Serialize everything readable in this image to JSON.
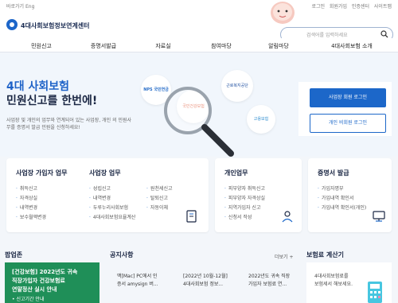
{
  "topbar": {
    "left": "바로가기  Eng",
    "right": "로그인  회원가입  인증센터  사이트맵"
  },
  "header": {
    "logo_text": "4대사회보험정보연계센터",
    "search_placeholder": "검색어를 입력하세요"
  },
  "nav": [
    "민원신고",
    "증명서발급",
    "자료실",
    "참여마당",
    "알림마당",
    "4대사회보험 소개"
  ],
  "hero": {
    "title_line1": "4대 사회보험",
    "title_line2": "민원신고를 한번에!",
    "desc": "사업장 및 개인의 업무와 연계되어 있는 사업장, 개인 의 민원사무를 증명서 발급 민원을 신청하세요!",
    "bubbles": [
      "NPS 국민연금",
      "국민건강보험",
      "근로복지공단",
      "고용보험"
    ]
  },
  "login": {
    "primary": "사업장 회원 로그인",
    "secondary": "개인 비회원 로그인"
  },
  "cards": [
    {
      "title": "사업장 가입자 업무",
      "items": [
        "취득신고",
        "자격상실",
        "내역변경",
        "보수월액변경"
      ]
    },
    {
      "title": "사업장 업무",
      "items": [
        "성립신고",
        "내역변경",
        "두루누리사회보험",
        "4대사회보험요율계산",
        "원천세신고",
        "탈퇴신고",
        "자동이체"
      ]
    },
    {
      "title": "개인업무",
      "items": [
        "피부양자 취득신고",
        "피부양자 자격상실",
        "지역가입자 신고",
        "신청서 작성"
      ]
    },
    {
      "title": "증명서 발급",
      "items": [
        "가입자명부",
        "가입내역 확인서",
        "가입내역 확인서(개인)"
      ]
    }
  ],
  "sections": {
    "popup": "팝업존",
    "notice": "공지사항",
    "more": "더보기 +",
    "calc": "보험료 계산기"
  },
  "popup": {
    "line1": "[건강보험] 2022년도 귀속",
    "line2": "직장가입자 건강보험료",
    "line3": "연말정산 실시 안내",
    "line4": "• 신고기간 안내"
  },
  "notices": [
    {
      "line1": "맥[Mac] PC에서 인",
      "line2": "증서 amysign 버..."
    },
    {
      "line1": "[2022년 10월-12월]",
      "line2": "4대사회보험 정보..."
    },
    {
      "line1": "2022년도 귀속 직장",
      "line2": "가입자 보험료 연..."
    }
  ],
  "calc": {
    "line1": "4대사회보험료를",
    "line2": "보험세서 해보세요."
  },
  "colors": {
    "primary": "#1c67c9",
    "navy": "#1b2744",
    "green": "#1f8f58"
  }
}
